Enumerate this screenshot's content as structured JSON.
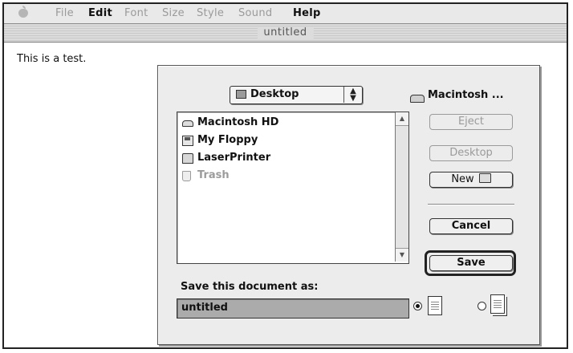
{
  "menubar": {
    "apple_icon": "apple-icon",
    "items": [
      {
        "label": "File",
        "active": false
      },
      {
        "label": "Edit",
        "active": true
      },
      {
        "label": "Font",
        "active": false
      },
      {
        "label": "Size",
        "active": false
      },
      {
        "label": "Style",
        "active": false
      },
      {
        "label": "Sound",
        "active": false
      },
      {
        "label": "Help",
        "active": true
      }
    ]
  },
  "window": {
    "title": "untitled",
    "body_text": "This is a test."
  },
  "dialog": {
    "location_popup": {
      "icon": "desktop-icon",
      "label": "Desktop"
    },
    "volume_label": "Macintosh ...",
    "files": [
      {
        "name": "Macintosh HD",
        "icon": "hard-disk-icon",
        "dimmed": false
      },
      {
        "name": "My Floppy",
        "icon": "floppy-icon",
        "dimmed": false
      },
      {
        "name": "LaserPrinter",
        "icon": "printer-folder-icon",
        "dimmed": false
      },
      {
        "name": "Trash",
        "icon": "trash-icon",
        "dimmed": true
      }
    ],
    "buttons": {
      "eject": "Eject",
      "desktop": "Desktop",
      "new": "New",
      "cancel": "Cancel",
      "save": "Save"
    },
    "save_prompt": "Save this document as:",
    "filename_value": "untitled",
    "format_options": [
      {
        "icon": "document-icon",
        "selected": true
      },
      {
        "icon": "stationery-icon",
        "selected": false
      }
    ]
  }
}
